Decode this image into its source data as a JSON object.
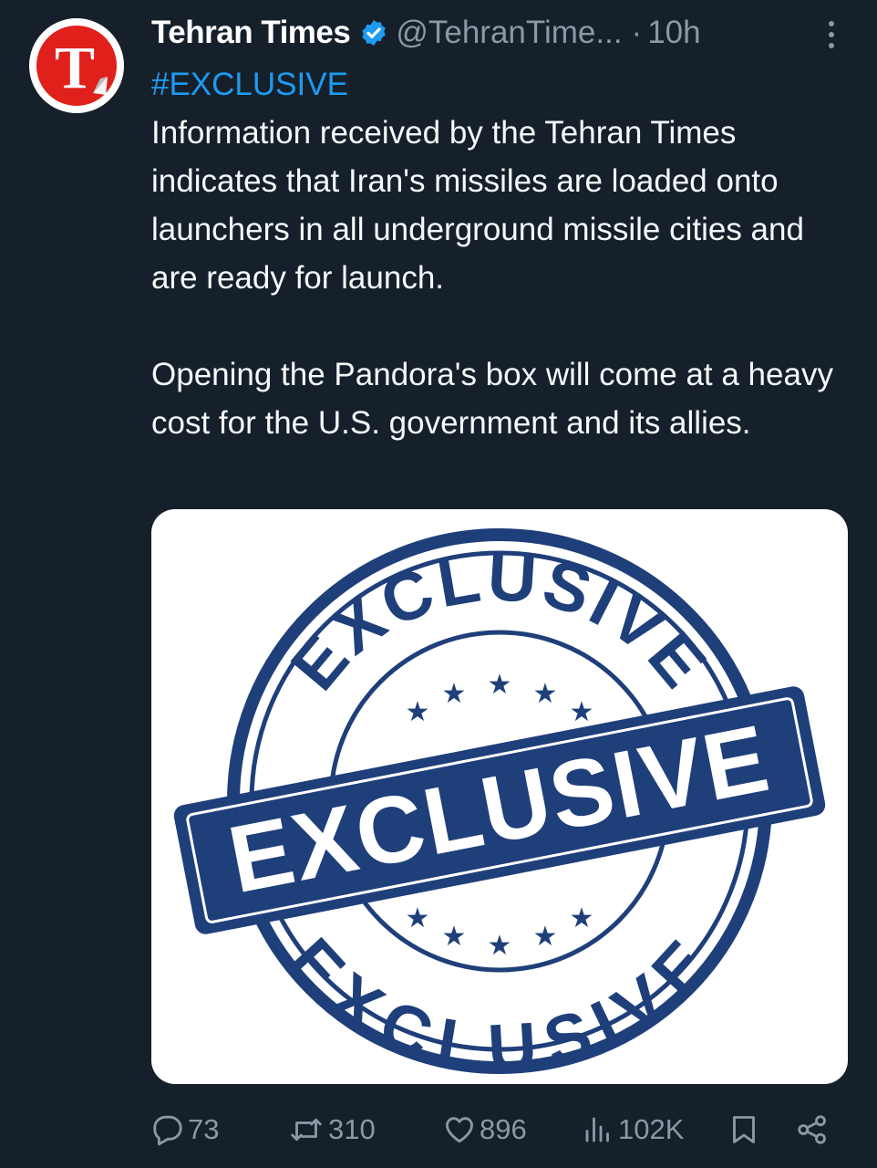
{
  "tweet": {
    "author": {
      "display_name": "Tehran Times",
      "handle": "@TehranTime...",
      "time": "10h",
      "avatar_letter": "T"
    },
    "hashtag": "#EXCLUSIVE",
    "paragraphs": [
      "Information received by the Tehran Times indicates that Iran's missiles are loaded onto launchers in all underground missile cities and are ready for launch.",
      "Opening the Pandora's box will come at a heavy cost for the U.S. government and its allies."
    ],
    "media": {
      "top_text": "EXCLUSIVE",
      "band_text": "EXCLUSIVE",
      "bottom_text": "EXCLUSIVE",
      "stamp_color": "#1f3f7a"
    },
    "stats": {
      "replies": "73",
      "reposts": "310",
      "likes": "896",
      "views": "102K"
    }
  },
  "colors": {
    "background": "#15202b",
    "muted": "#8b98a5",
    "link": "#1d9bf0",
    "verified": "#1d9bf0",
    "brand_red": "#e0201b"
  },
  "icons": [
    "verified-badge-icon",
    "more-options-icon",
    "reply-icon",
    "repost-icon",
    "like-icon",
    "views-icon",
    "bookmark-icon",
    "share-icon"
  ]
}
